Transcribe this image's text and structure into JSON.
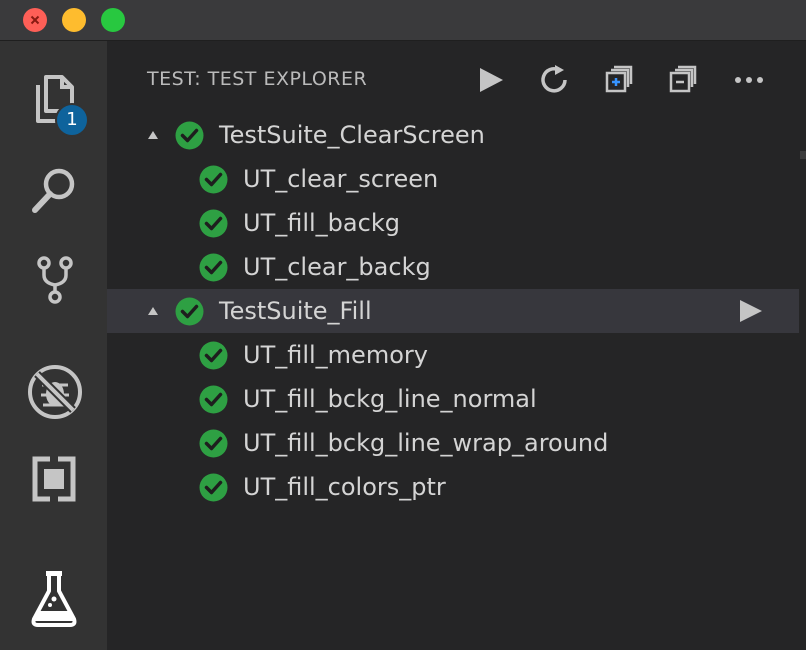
{
  "window": {
    "controls": [
      "close",
      "minimize",
      "zoom"
    ]
  },
  "activity_bar": {
    "items": [
      {
        "name": "explorer",
        "icon": "files-icon",
        "badge": "1"
      },
      {
        "name": "search",
        "icon": "search-icon"
      },
      {
        "name": "source-control",
        "icon": "source-control-icon"
      },
      {
        "name": "debug",
        "icon": "no-bug-icon"
      },
      {
        "name": "extensions",
        "icon": "extensions-icon"
      },
      {
        "name": "test",
        "icon": "flask-icon"
      }
    ]
  },
  "panel": {
    "title": "TEST: TEST EXPLORER",
    "toolbar": [
      {
        "name": "run-all",
        "icon": "play-icon"
      },
      {
        "name": "reload",
        "icon": "refresh-icon"
      },
      {
        "name": "expand-all",
        "icon": "expand-all-icon"
      },
      {
        "name": "collapse-all",
        "icon": "collapse-all-icon"
      },
      {
        "name": "more-actions",
        "icon": "ellipsis-icon"
      }
    ]
  },
  "tests": {
    "suites": [
      {
        "label": "TestSuite_ClearScreen",
        "status": "passed",
        "tests": [
          {
            "label": "UT_clear_screen",
            "status": "passed"
          },
          {
            "label": "UT_fill_backg",
            "status": "passed"
          },
          {
            "label": "UT_clear_backg",
            "status": "passed"
          }
        ]
      },
      {
        "label": "TestSuite_Fill",
        "status": "passed",
        "selected": true,
        "tests": [
          {
            "label": "UT_fill_memory",
            "status": "passed"
          },
          {
            "label": "UT_fill_bckg_line_normal",
            "status": "passed"
          },
          {
            "label": "UT_fill_bckg_line_wrap_around",
            "status": "passed"
          },
          {
            "label": "UT_fill_colors_ptr",
            "status": "passed"
          }
        ]
      }
    ]
  },
  "colors": {
    "pass": "#2ea043",
    "badge": "#0e639c",
    "selection": "#37373d",
    "activity_bar": "#333333",
    "sidebar": "#252526"
  }
}
